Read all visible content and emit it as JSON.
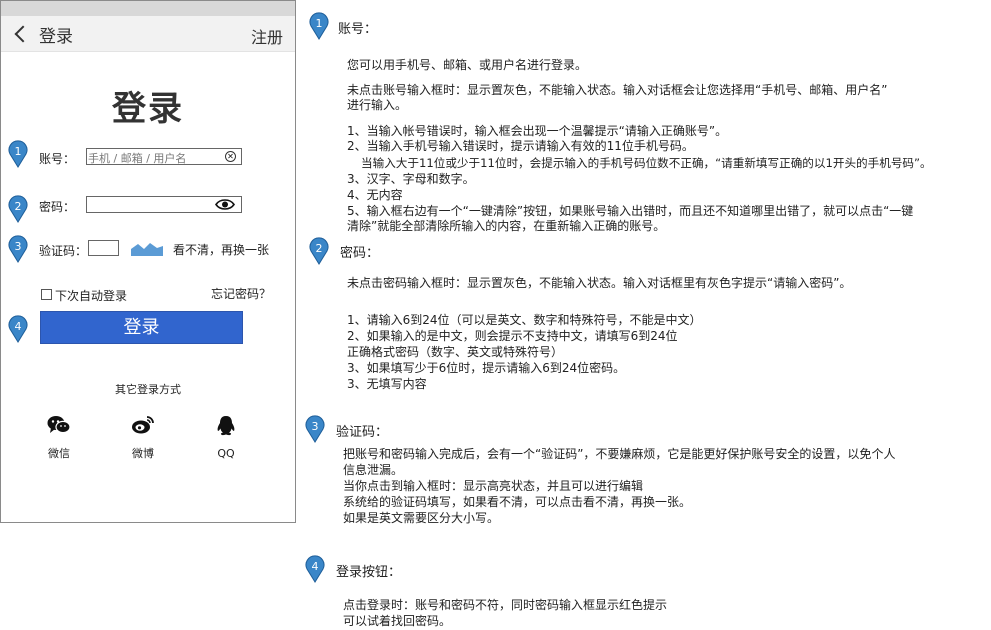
{
  "phone": {
    "nav": {
      "back_label": "登录",
      "register_label": "注册"
    },
    "title": "登录",
    "account": {
      "label": "账号：",
      "placeholder": "手机 / 邮箱 / 用户名",
      "clear_glyph": "✕"
    },
    "password": {
      "label": "密码："
    },
    "captcha": {
      "label": "验证码：",
      "refresh_label": "看不清，再换一张"
    },
    "remember_label": "下次自动登录",
    "forgot_label": "忘记密码？",
    "login_button": "登录",
    "other_login_title": "其它登录方式",
    "social": [
      {
        "label": "微信",
        "icon": "wechat-icon"
      },
      {
        "label": "微博",
        "icon": "weibo-icon"
      },
      {
        "label": "QQ",
        "icon": "qq-icon"
      }
    ]
  },
  "markers": [
    "1",
    "2",
    "3",
    "4"
  ],
  "annotations": {
    "account": {
      "title": "账号：",
      "lines": [
        "您可以用手机号、邮箱、或用户名进行登录。",
        "未点击账号输入框时：显示置灰色，不能输入状态。输入对话框会让您选择用“手机号、邮箱、用户名”",
        "进行输入。",
        "1、当输入帐号错误时，输入框会出现一个温馨提示“请输入正确账号”。",
        "2、当输入手机号输入错误时，提示请输入有效的11位手机号码。",
        "当输入大于11位或少于11位时，会提示输入的手机号码位数不正确，“请重新填写正确的以1开头的手机号码”。",
        "3、汉字、字母和数字。",
        "4、无内容",
        "5、输入框右边有一个“一键清除”按钮，如果账号输入出错时，而且还不知道哪里出错了，就可以点击“一键",
        "清除”就能全部清除所输入的内容，在重新输入正确的账号。"
      ]
    },
    "password": {
      "title": "密码：",
      "lines": [
        "未点击密码输入框时：显示置灰色，不能输入状态。输入对话框里有灰色字提示“请输入密码”。",
        "1、请输入6到24位（可以是英文、数字和特殊符号，不能是中文）",
        "2、如果输入的是中文，则会提示不支持中文，请填写6到24位",
        "正确格式密码（数字、英文或特殊符号）",
        "3、如果填写少于6位时，提示请输入6到24位密码。",
        "3、无填写内容"
      ]
    },
    "captcha": {
      "title": "验证码：",
      "lines": [
        "把账号和密码输入完成后，会有一个“验证码”，不要嫌麻烦，它是能更好保护账号安全的设置，以免个人",
        "信息泄漏。",
        "当你点击到输入框时：显示高亮状态，并且可以进行编辑",
        "系统给的验证码填写，如果看不清，可以点击看不清，再换一张。",
        "如果是英文需要区分大小写。"
      ]
    },
    "login": {
      "title": "登录按钮：",
      "lines": [
        "点击登录时：账号和密码不符，同时密码输入框显示红色提示",
        "可以试着找回密码。"
      ]
    }
  },
  "colors": {
    "primary": "#3165ce",
    "marker": "#3a86c8",
    "gray_bar": "#d8d8d8"
  }
}
